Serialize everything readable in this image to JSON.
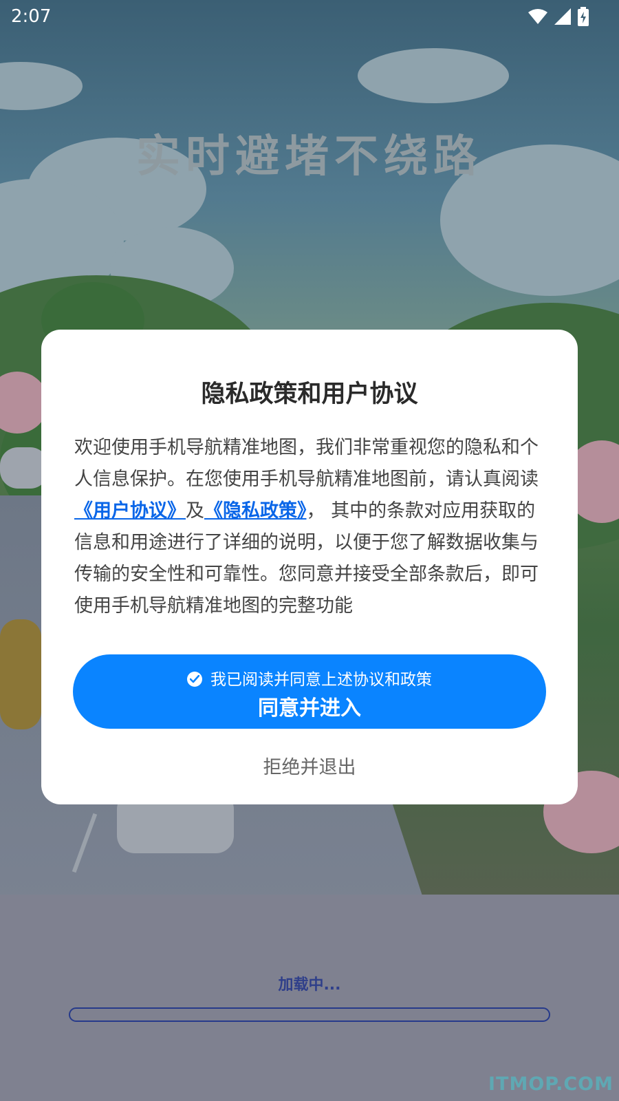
{
  "status_bar": {
    "time": "2:07",
    "icons": [
      "wifi-icon",
      "signal-icon",
      "battery-charging-icon"
    ]
  },
  "splash": {
    "slogan": "实时避堵不绕路",
    "loading_text": "加载中...",
    "loading_progress": 0,
    "watermark": "ITMOP.COM"
  },
  "dialog": {
    "title": "隐私政策和用户协议",
    "body_intro": "欢迎使用手机导航精准地图，我们非常重视您的隐私和个人信息保护。在您使用手机导航精准地图前，请认真阅读",
    "link_user_agreement": "《用户协议》",
    "connector": "及",
    "link_privacy_policy": "《隐私政策》",
    "body_rest": "， 其中的条款对应用获取的信息和用途进行了详细的说明，以便于您了解数据收集与传输的安全性和可靠性。您同意并接受全部条款后，即可使用手机导航精准地图的完整功能",
    "checkbox_label": "我已阅读并同意上述协议和政策",
    "checkbox_checked": true,
    "agree_button": "同意并进入",
    "reject_button": "拒绝并退出"
  },
  "colors": {
    "primary": "#0a84ff",
    "link": "#0a66e8",
    "loading": "#263a8a"
  }
}
